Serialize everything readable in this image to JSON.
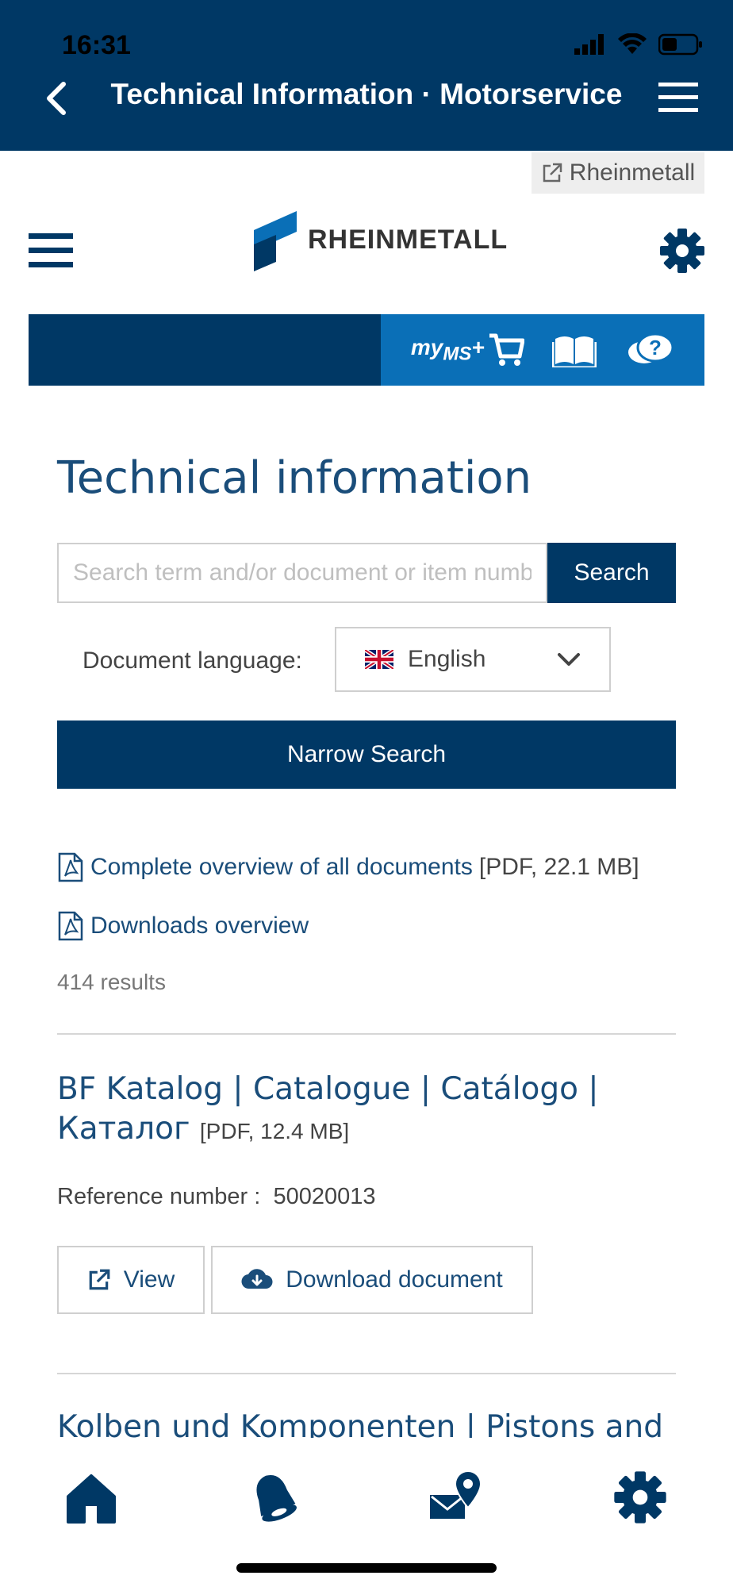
{
  "status_bar": {
    "time": "16:31"
  },
  "app_header": {
    "title": "Technical Information · Motorservice"
  },
  "external_link": {
    "label": "Rheinmetall"
  },
  "logo": {
    "text": "RHEINMETALL"
  },
  "nav": {
    "myms_label_my": "my",
    "myms_label_ms": "MS",
    "myms_plus": "+"
  },
  "page": {
    "heading": "Technical information"
  },
  "search": {
    "placeholder": "Search term and/or document or item number",
    "button_label": "Search"
  },
  "language": {
    "label": "Document language:",
    "selected": "English"
  },
  "narrow_search_label": "Narrow Search",
  "links": {
    "overview": {
      "text": "Complete overview of all documents",
      "meta": "[PDF, 22.1 MB]"
    },
    "downloads": {
      "text": "Downloads overview"
    }
  },
  "results_count": "414 results",
  "results": [
    {
      "title": "BF Katalog | Catalogue | Catálogo |",
      "title_line2": "Каталог",
      "meta": "[PDF, 12.4 MB]",
      "reference_label": "Reference number :",
      "reference_value": "50020013",
      "view_label": "View",
      "download_label": "Download document"
    },
    {
      "title": "Kolben und Komponenten | Pistons and"
    }
  ],
  "colors": {
    "primary": "#003865",
    "accent": "#0a6fb7",
    "link": "#1a4d7a"
  },
  "icons": [
    "back-icon",
    "menu-icon",
    "external-link-icon",
    "gear-icon",
    "cart-icon",
    "book-icon",
    "help-chat-icon",
    "pdf-icon",
    "flag-uk-icon",
    "chevron-down-icon",
    "cloud-download-icon",
    "home-icon",
    "bell-icon",
    "mail-location-icon"
  ]
}
